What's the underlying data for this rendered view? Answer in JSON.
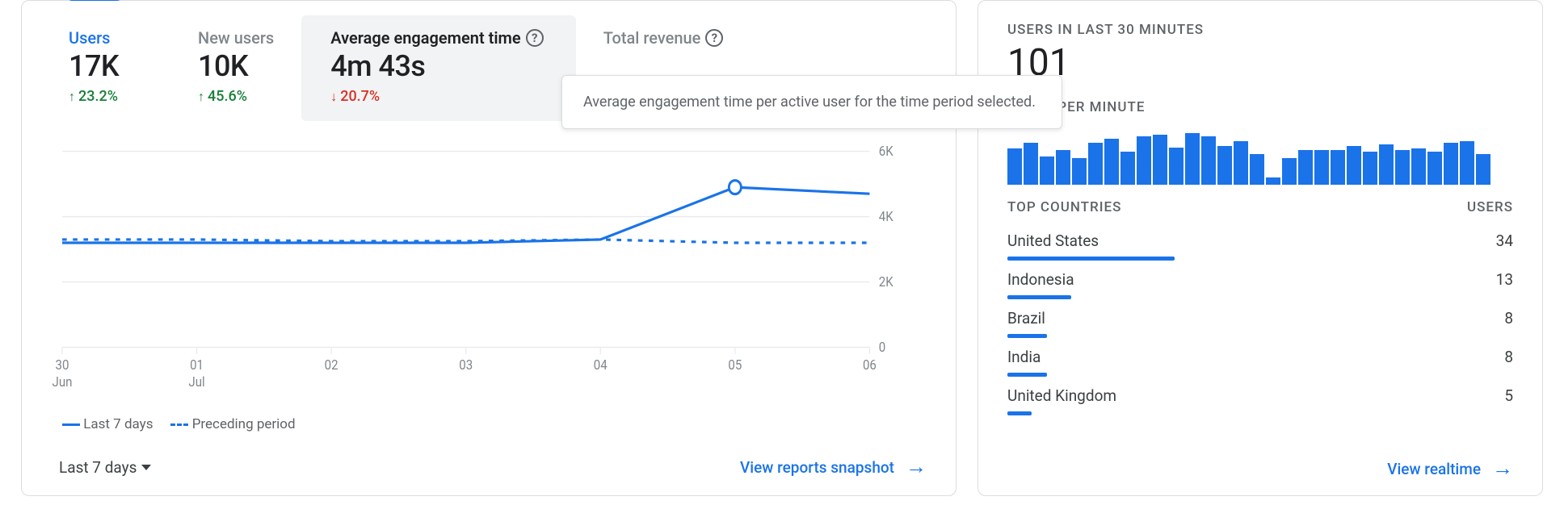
{
  "main": {
    "metrics": [
      {
        "id": "users",
        "label": "Users",
        "value": "17K",
        "delta": "23.2%",
        "dir": "up",
        "selected": false,
        "active_link": true,
        "help": false
      },
      {
        "id": "new-users",
        "label": "New users",
        "value": "10K",
        "delta": "45.6%",
        "dir": "up",
        "selected": false,
        "active_link": false,
        "help": false
      },
      {
        "id": "avg-engagement",
        "label": "Average engagement time",
        "value": "4m 43s",
        "delta": "20.7%",
        "dir": "down",
        "selected": true,
        "active_link": false,
        "help": true
      },
      {
        "id": "total-revenue",
        "label": "Total revenue",
        "value": "",
        "delta": "",
        "dir": "",
        "selected": false,
        "active_link": false,
        "help": true
      }
    ],
    "tooltip": "Average engagement time per active user for the time period selected.",
    "legend": {
      "current": "Last 7 days",
      "previous": "Preceding period"
    },
    "range_label": "Last 7 days",
    "footer_link": "View reports snapshot"
  },
  "chart_data": {
    "type": "line",
    "title": "",
    "xlabel": "",
    "ylabel": "",
    "ylim": [
      0,
      6000
    ],
    "yticks": [
      0,
      2000,
      4000,
      6000
    ],
    "ytick_labels": [
      "0",
      "2K",
      "4K",
      "6K"
    ],
    "categories": [
      "30 Jun",
      "01 Jul",
      "02",
      "03",
      "04",
      "05",
      "06"
    ],
    "series": [
      {
        "name": "Last 7 days",
        "style": "solid",
        "values": [
          3200,
          3200,
          3200,
          3200,
          3300,
          4900,
          4700
        ]
      },
      {
        "name": "Preceding period",
        "style": "dashed",
        "values": [
          3300,
          3300,
          3250,
          3250,
          3300,
          3200,
          3200
        ]
      }
    ],
    "highlight_index": 5
  },
  "realtime": {
    "title": "USERS IN LAST 30 MINUTES",
    "value": "101",
    "spark_label": "USERS PER MINUTE",
    "spark_values": [
      42,
      50,
      32,
      40,
      30,
      50,
      55,
      38,
      58,
      60,
      43,
      62,
      58,
      45,
      52,
      35,
      5,
      30,
      40,
      40,
      40,
      45,
      38,
      48,
      40,
      42,
      38,
      50,
      52,
      35
    ],
    "countries_header": {
      "left": "TOP COUNTRIES",
      "right": "USERS"
    },
    "countries": [
      {
        "name": "United States",
        "users": 34
      },
      {
        "name": "Indonesia",
        "users": 13
      },
      {
        "name": "Brazil",
        "users": 8
      },
      {
        "name": "India",
        "users": 8
      },
      {
        "name": "United Kingdom",
        "users": 5
      }
    ],
    "footer_link": "View realtime"
  }
}
